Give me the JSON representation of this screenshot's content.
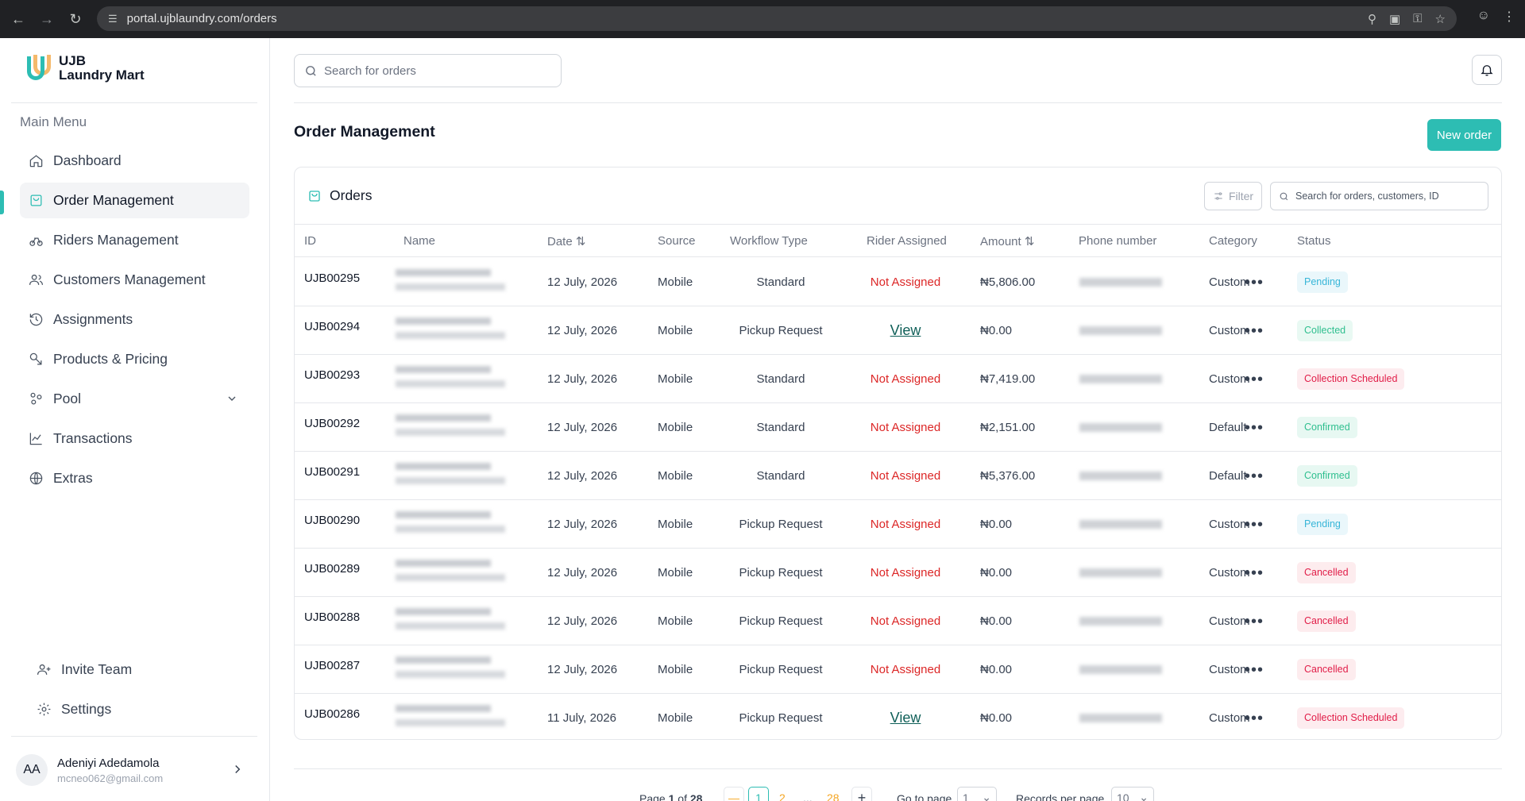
{
  "browser": {
    "url": "portal.ujblaundry.com/orders"
  },
  "brand": {
    "line1": "UJB",
    "line2": "Laundry Mart",
    "accent_color": "#2dbdb3",
    "secondary_color": "#f5b25b"
  },
  "sidebar": {
    "heading": "Main Menu",
    "items": [
      {
        "label": "Dashboard",
        "icon": "home-icon"
      },
      {
        "label": "Order Management",
        "icon": "shopping-bag-icon",
        "active": true
      },
      {
        "label": "Riders Management",
        "icon": "bike-icon"
      },
      {
        "label": "Customers Management",
        "icon": "users-icon"
      },
      {
        "label": "Assignments",
        "icon": "history-icon"
      },
      {
        "label": "Products & Pricing",
        "icon": "tags-icon"
      },
      {
        "label": "Pool",
        "icon": "pool-icon",
        "expandable": true
      },
      {
        "label": "Transactions",
        "icon": "chart-line-icon"
      },
      {
        "label": "Extras",
        "icon": "globe-icon"
      }
    ],
    "bottom_items": [
      {
        "label": "Invite Team",
        "icon": "user-plus-icon"
      },
      {
        "label": "Settings",
        "icon": "gear-icon"
      }
    ],
    "user": {
      "initials": "AA",
      "name": "Adeniyi Adedamola",
      "email": "mcneo062@gmail.com"
    }
  },
  "header": {
    "search_placeholder": "Search for orders"
  },
  "page": {
    "title": "Order Management",
    "new_order_label": "New order"
  },
  "orders": {
    "card_title": "Orders",
    "filter_label": "Filter",
    "search_placeholder": "Search for orders, customers, ID",
    "columns": [
      "ID",
      "Name",
      "Date",
      "Source",
      "Workflow Type",
      "Rider Assigned",
      "Amount",
      "Phone number",
      "Category",
      "Status"
    ],
    "rows": [
      {
        "id": "UJB00295",
        "date": "12 July, 2026",
        "source": "Mobile",
        "workflow": "Standard",
        "rider": "Not Assigned",
        "amount": "₦5,806.00",
        "category": "Custom",
        "status": "Pending",
        "status_type": "pending"
      },
      {
        "id": "UJB00294",
        "date": "12 July, 2026",
        "source": "Mobile",
        "workflow": "Pickup Request",
        "rider": "View",
        "amount": "₦0.00",
        "category": "Custom",
        "status": "Collected",
        "status_type": "collected"
      },
      {
        "id": "UJB00293",
        "date": "12 July, 2026",
        "source": "Mobile",
        "workflow": "Standard",
        "rider": "Not Assigned",
        "amount": "₦7,419.00",
        "category": "Custom",
        "status": "Collection Scheduled",
        "status_type": "scheduled"
      },
      {
        "id": "UJB00292",
        "date": "12 July, 2026",
        "source": "Mobile",
        "workflow": "Standard",
        "rider": "Not Assigned",
        "amount": "₦2,151.00",
        "category": "Default",
        "status": "Confirmed",
        "status_type": "confirmed"
      },
      {
        "id": "UJB00291",
        "date": "12 July, 2026",
        "source": "Mobile",
        "workflow": "Standard",
        "rider": "Not Assigned",
        "amount": "₦5,376.00",
        "category": "Default",
        "status": "Confirmed",
        "status_type": "confirmed"
      },
      {
        "id": "UJB00290",
        "date": "12 July, 2026",
        "source": "Mobile",
        "workflow": "Pickup Request",
        "rider": "Not Assigned",
        "amount": "₦0.00",
        "category": "Custom",
        "status": "Pending",
        "status_type": "pending"
      },
      {
        "id": "UJB00289",
        "date": "12 July, 2026",
        "source": "Mobile",
        "workflow": "Pickup Request",
        "rider": "Not Assigned",
        "amount": "₦0.00",
        "category": "Custom",
        "status": "Cancelled",
        "status_type": "cancelled"
      },
      {
        "id": "UJB00288",
        "date": "12 July, 2026",
        "source": "Mobile",
        "workflow": "Pickup Request",
        "rider": "Not Assigned",
        "amount": "₦0.00",
        "category": "Custom",
        "status": "Cancelled",
        "status_type": "cancelled"
      },
      {
        "id": "UJB00287",
        "date": "12 July, 2026",
        "source": "Mobile",
        "workflow": "Pickup Request",
        "rider": "Not Assigned",
        "amount": "₦0.00",
        "category": "Custom",
        "status": "Cancelled",
        "status_type": "cancelled"
      },
      {
        "id": "UJB00286",
        "date": "11 July, 2026",
        "source": "Mobile",
        "workflow": "Pickup Request",
        "rider": "View",
        "amount": "₦0.00",
        "category": "Custom",
        "status": "Collection Scheduled",
        "status_type": "scheduled"
      }
    ]
  },
  "pagination": {
    "page_prefix": "Page",
    "current_page": "1",
    "of_label": "of",
    "total_pages": "28",
    "pages": [
      "1",
      "2",
      "...",
      "28"
    ],
    "goto_label": "Go to page",
    "goto_value": "1",
    "records_label": "Records per page",
    "records_value": "10"
  }
}
